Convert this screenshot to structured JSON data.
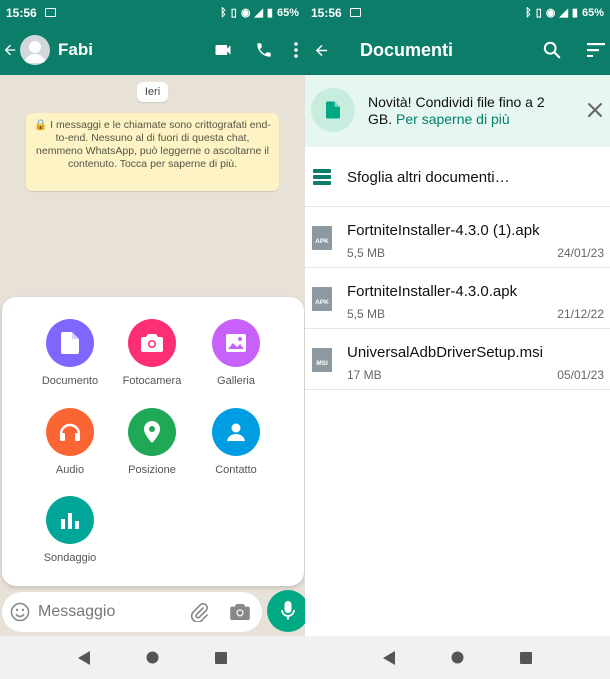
{
  "colors": {
    "primary": "#0b7d69",
    "accent": "#00a884",
    "banner": "#e6f6f0"
  },
  "status": {
    "time": "15:56",
    "battery": "65%"
  },
  "chat": {
    "contact_name": "Fabi",
    "date_chip": "Ieri",
    "encryption_notice": "🔒 I messaggi e le chiamate sono crittografati end-to-end. Nessuno al di fuori di questa chat, nemmeno WhatsApp, può leggerne o ascoltarne il contenuto. Tocca per saperne di più.",
    "compose_placeholder": "Messaggio",
    "attachments": [
      {
        "label": "Documento",
        "color": "#7f66ff",
        "icon": "document-icon"
      },
      {
        "label": "Fotocamera",
        "color": "#fe2e74",
        "icon": "camera-icon"
      },
      {
        "label": "Galleria",
        "color": "#c861fa",
        "icon": "gallery-icon"
      },
      {
        "label": "Audio",
        "color": "#fa6533",
        "icon": "headphones-icon"
      },
      {
        "label": "Posizione",
        "color": "#1fa855",
        "icon": "location-icon"
      },
      {
        "label": "Contatto",
        "color": "#009de2",
        "icon": "contact-icon"
      },
      {
        "label": "Sondaggio",
        "color": "#02a698",
        "icon": "poll-icon"
      }
    ]
  },
  "documents": {
    "title": "Documenti",
    "banner_text": "Novità! Condividi file fino a 2 GB.",
    "banner_link": "Per saperne di più",
    "browse_label": "Sfoglia altri documenti…",
    "files": [
      {
        "name": "FortniteInstaller-4.3.0 (1).apk",
        "size": "5,5 MB",
        "date": "24/01/23",
        "ext": "APK"
      },
      {
        "name": "FortniteInstaller-4.3.0.apk",
        "size": "5,5 MB",
        "date": "21/12/22",
        "ext": "APK"
      },
      {
        "name": "UniversalAdbDriverSetup.msi",
        "size": "17 MB",
        "date": "05/01/23",
        "ext": "MSI"
      }
    ]
  }
}
